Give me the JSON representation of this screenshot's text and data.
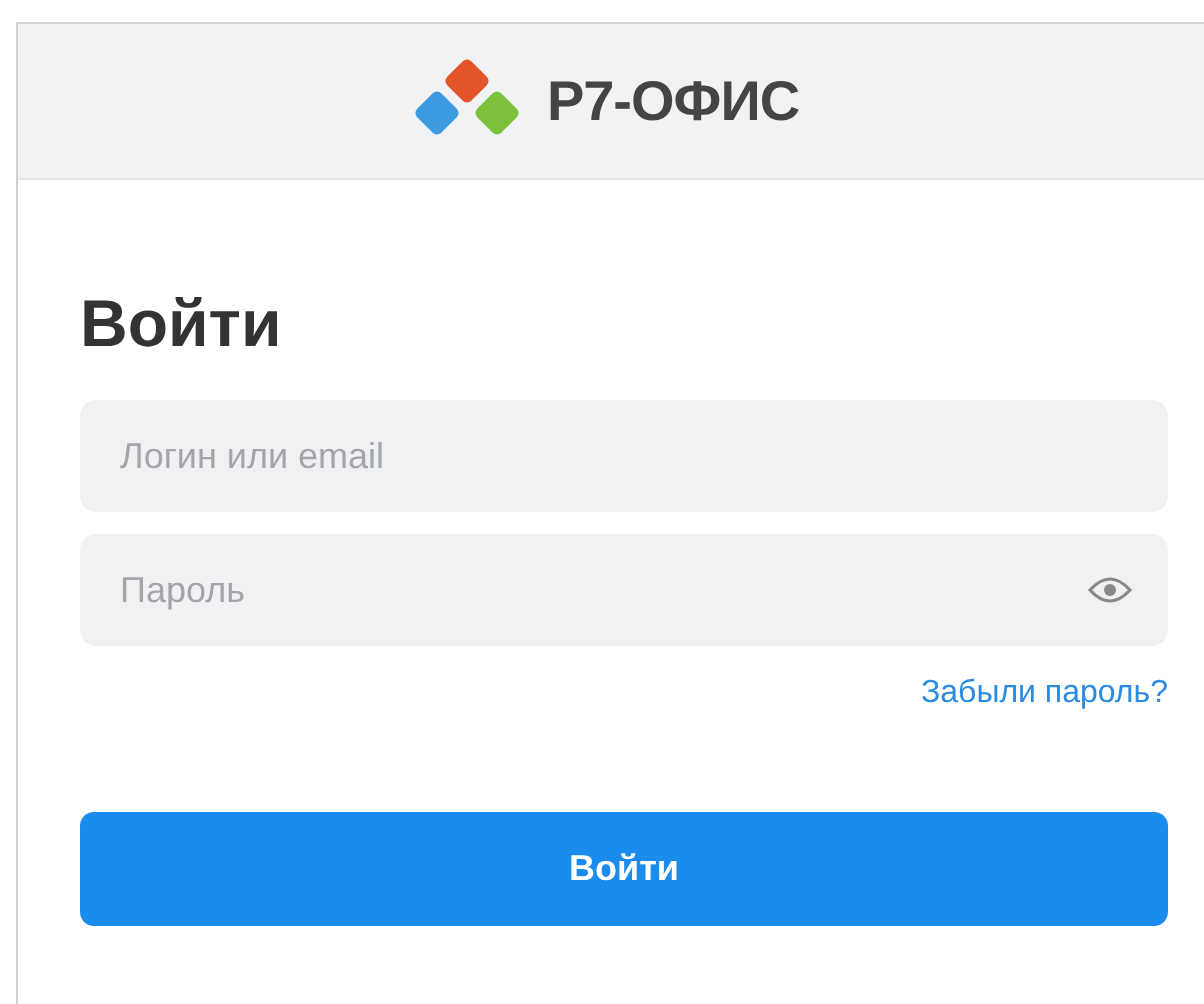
{
  "header": {
    "logo_text": "Р7-ОФИС"
  },
  "title": "Войти",
  "login_field": {
    "placeholder": "Логин или email"
  },
  "password_field": {
    "placeholder": "Пароль"
  },
  "forgot_link": "Забыли пароль?",
  "submit_button": "Войти"
}
